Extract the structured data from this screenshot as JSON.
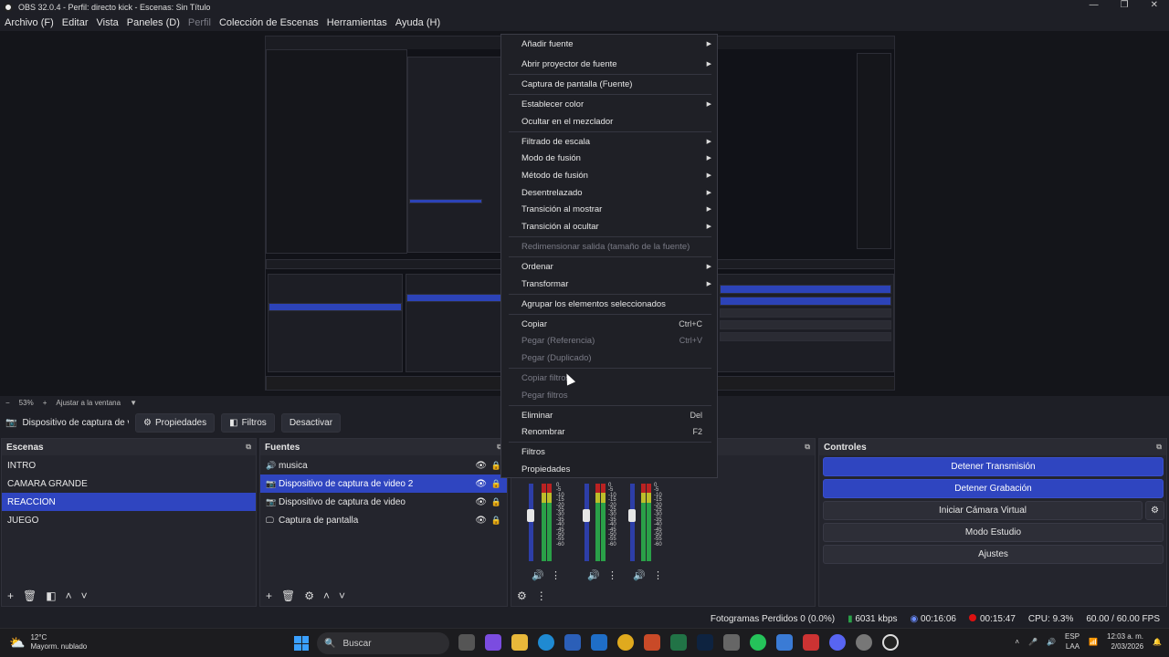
{
  "window": {
    "title": "OBS 32.0.4 - Perfil: directo kick - Escenas: Sin Título",
    "minimize": "—",
    "maximize": "❐",
    "close": "✕"
  },
  "menubar": [
    {
      "label": "Archivo (F)",
      "disabled": false
    },
    {
      "label": "Editar",
      "disabled": false
    },
    {
      "label": "Vista",
      "disabled": false
    },
    {
      "label": "Paneles (D)",
      "disabled": false
    },
    {
      "label": "Perfil",
      "disabled": true
    },
    {
      "label": "Colección de Escenas",
      "disabled": false
    },
    {
      "label": "Herramientas",
      "disabled": false
    },
    {
      "label": "Ayuda (H)",
      "disabled": false
    }
  ],
  "preview": {
    "zoom": "53%",
    "fit": "Ajustar a la ventana"
  },
  "source_toolbar": {
    "source_name": "Dispositivo de captura de v",
    "properties": "Propiedades",
    "filters": "Filtros",
    "deactivate": "Desactivar"
  },
  "scenes": {
    "title": "Escenas",
    "items": [
      "INTRO",
      "CAMARA GRANDE",
      "REACCION",
      "JUEGO"
    ],
    "selected": 2
  },
  "sources": {
    "title": "Fuentes",
    "items": [
      {
        "label": "musica",
        "icon": "music-icon"
      },
      {
        "label": "Dispositivo de captura de video 2",
        "icon": "camera-icon"
      },
      {
        "label": "Dispositivo de captura de video",
        "icon": "camera-icon"
      },
      {
        "label": "Captura de pantalla",
        "icon": "monitor-icon"
      }
    ],
    "selected": 1
  },
  "mixer": {
    "scale": [
      "0",
      "-5",
      "-10",
      "-15",
      "-20",
      "-25",
      "-30",
      "-35",
      "-40",
      "-45",
      "-50",
      "-55",
      "-60"
    ]
  },
  "controls": {
    "title": "Controles",
    "stop_stream": "Detener Transmisión",
    "stop_record": "Detener Grabación",
    "virtual_cam": "Iniciar Cámara Virtual",
    "studio_mode": "Modo Estudio",
    "settings": "Ajustes"
  },
  "status": {
    "dropped": "Fotogramas Perdidos 0 (0.0%)",
    "bitrate": "6031 kbps",
    "stream_time": "00:16:06",
    "rec_time": "00:15:47",
    "cpu": "CPU: 9.3%",
    "fps": "60.00 / 60.00 FPS"
  },
  "context_menu": [
    {
      "label": "Añadir fuente",
      "arrow": true
    },
    {
      "label": "Abrir proyector de fuente",
      "arrow": true
    },
    {
      "label": "Captura de pantalla (Fuente)"
    },
    {
      "label": "Establecer color",
      "arrow": true
    },
    {
      "label": "Ocultar en el mezclador"
    },
    {
      "label": "Filtrado de escala",
      "arrow": true
    },
    {
      "label": "Modo de fusión",
      "arrow": true
    },
    {
      "label": "Método de fusión",
      "arrow": true
    },
    {
      "label": "Desentrelazado",
      "arrow": true
    },
    {
      "label": "Transición al mostrar",
      "arrow": true
    },
    {
      "label": "Transición al ocultar",
      "arrow": true
    },
    {
      "label": "Redimensionar salida (tamaño de la fuente)",
      "disabled": true
    },
    {
      "label": "Ordenar",
      "arrow": true
    },
    {
      "label": "Transformar",
      "arrow": true
    },
    {
      "label": "Agrupar los elementos seleccionados"
    },
    {
      "label": "Copiar",
      "shortcut": "Ctrl+C"
    },
    {
      "label": "Pegar (Referencia)",
      "shortcut": "Ctrl+V",
      "disabled": true
    },
    {
      "label": "Pegar (Duplicado)",
      "disabled": true
    },
    {
      "label": "Copiar filtros",
      "disabled": true
    },
    {
      "label": "Pegar filtros",
      "disabled": true
    },
    {
      "label": "Eliminar",
      "shortcut": "Del"
    },
    {
      "label": "Renombrar",
      "shortcut": "F2"
    },
    {
      "label": "Filtros"
    },
    {
      "label": "Propiedades"
    }
  ],
  "taskbar": {
    "temp": "12°C",
    "weather": "Mayorm. nublado",
    "search": "Buscar",
    "lang": "ESP",
    "lang2": "LAA",
    "time": "12:03 a. m.",
    "date": "2/03/2026"
  },
  "colors": {
    "accent": "#2f45c0",
    "background": "#1e1f26",
    "panel": "#24252d"
  }
}
